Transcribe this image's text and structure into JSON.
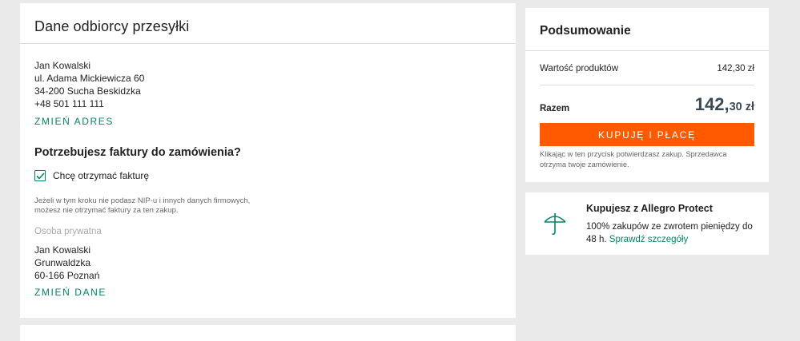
{
  "recipient": {
    "title": "Dane odbiorcy przesyłki",
    "address_lines": [
      "Jan Kowalski",
      "ul. Adama Mickiewicza 60",
      "34-200 Sucha Beskidzka",
      "+48 501 111 111"
    ],
    "change_address_label": "ZMIEŃ ADRES"
  },
  "invoice": {
    "question": "Potrzebujesz faktury do zamówienia?",
    "checkbox_label": "Chcę otrzymać fakturę",
    "checkbox_checked": true,
    "note_lines": [
      "Jeżeli w tym kroku nie podasz NIP-u i innych danych firmowych,",
      "możesz nie otrzymać faktury za ten zakup."
    ],
    "person_type": "Osoba prywatna",
    "address_lines": [
      "Jan Kowalski",
      "Grunwaldzka",
      "60-166 Poznań"
    ],
    "change_data_label": "ZMIEŃ DANE"
  },
  "summary": {
    "title": "Podsumowanie",
    "products_label": "Wartość produktów",
    "products_value": "142,30 zł",
    "total_label": "Razem",
    "total_int": "142,",
    "total_dec": "30",
    "total_currency": "zł",
    "buy_button_label": "KUPUJĘ I PŁACĘ",
    "note_lines": [
      "Klikając w ten przycisk potwierdzasz zakup. Sprzedawca",
      "otrzyma twoje zamówienie."
    ]
  },
  "protect": {
    "title": "Kupujesz z Allegro Protect",
    "text": "100% zakupów ze zwrotem pieniędzy do 48 h.",
    "link": "Sprawdź szczegóły",
    "icon": "umbrella-icon"
  },
  "colors": {
    "accent_green": "#00846a",
    "buy_orange": "#ff5a00",
    "background": "#eaeaea"
  }
}
